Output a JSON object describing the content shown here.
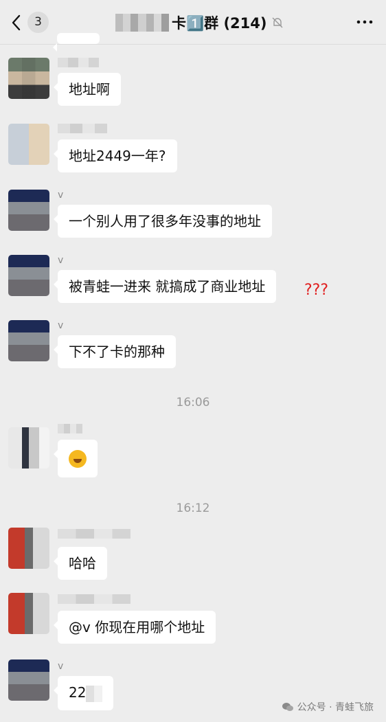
{
  "header": {
    "unread_count": "3",
    "title": "卡1️⃣群 (214)"
  },
  "messages": [
    {
      "id": "m1",
      "name": "",
      "text": "地址啊"
    },
    {
      "id": "m2",
      "name": "",
      "text": "地址2449一年?"
    },
    {
      "id": "m3",
      "name": "v",
      "text": "一个别人用了很多年没事的地址"
    },
    {
      "id": "m4",
      "name": "v",
      "text": "被青蛙一进来 就搞成了商业地址",
      "annotation": "???"
    },
    {
      "id": "m5",
      "name": "v",
      "text": "下不了卡的那种"
    },
    {
      "id": "m6",
      "name": "",
      "text": ""
    },
    {
      "id": "m7",
      "name": "",
      "text": "哈哈"
    },
    {
      "id": "m8",
      "name": "",
      "text": "@v 你现在用哪个地址"
    },
    {
      "id": "m9",
      "name": "v",
      "text": "22"
    }
  ],
  "timestamps": [
    "16:06",
    "16:12"
  ],
  "watermark": "公众号 · 青蛙飞旅"
}
